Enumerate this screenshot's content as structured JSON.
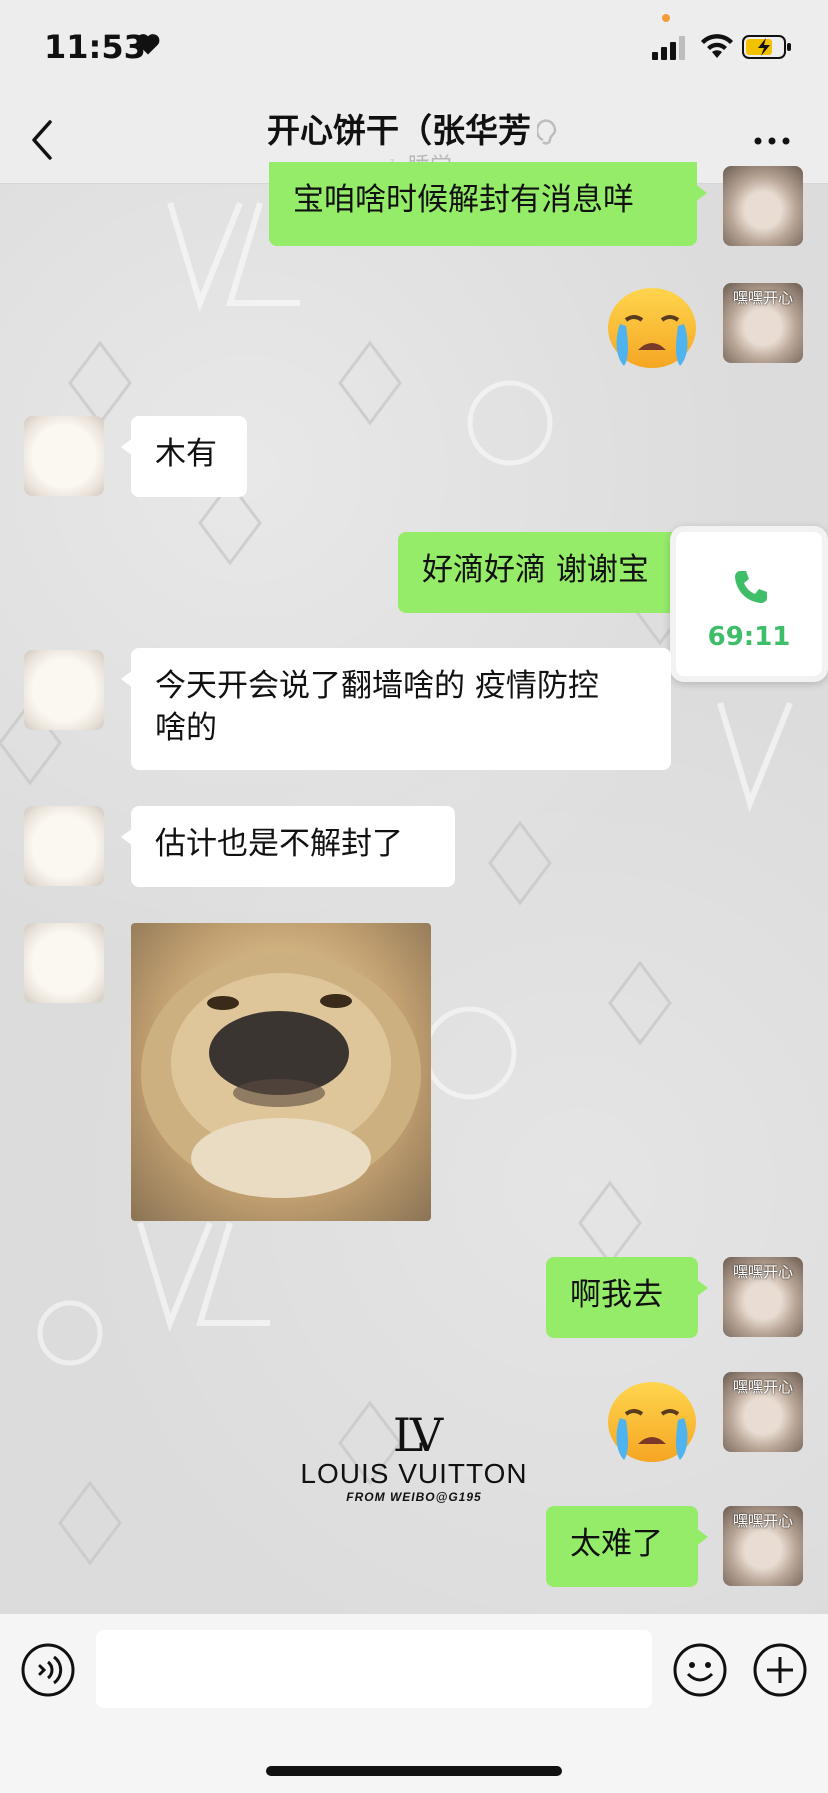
{
  "status_bar": {
    "time": "11:53",
    "icons": [
      "heart-icon",
      "signal-icon",
      "wifi-icon",
      "battery-charging-icon"
    ]
  },
  "header": {
    "title": "开心饼干（张华芳",
    "status": "睡觉",
    "icons": [
      "back-chevron-icon",
      "ear-icon",
      "sleep-icon",
      "more-dots-icon"
    ]
  },
  "avatar_labels": {
    "me": "嘿嘿开心"
  },
  "messages": [
    {
      "sender": "me",
      "type": "text",
      "text": "宝咱啥时候解封有消息咩"
    },
    {
      "sender": "me",
      "type": "emoji",
      "emoji": "loudly-crying-face"
    },
    {
      "sender": "them",
      "type": "text",
      "text": "木有"
    },
    {
      "sender": "me",
      "type": "text",
      "text": "好滴好滴 谢谢宝"
    },
    {
      "sender": "them",
      "type": "text",
      "text_line1": "今天开会说了翻墙啥的 疫情防控",
      "text_line2": "啥的"
    },
    {
      "sender": "them",
      "type": "text",
      "text": "估计也是不解封了"
    },
    {
      "sender": "them",
      "type": "sticker",
      "sticker": "squished-dog-face"
    },
    {
      "sender": "me",
      "type": "text",
      "text": "啊我去"
    },
    {
      "sender": "me",
      "type": "emoji",
      "emoji": "loudly-crying-face"
    },
    {
      "sender": "me",
      "type": "text",
      "text": "太难了"
    }
  ],
  "call_card": {
    "duration": "69:11"
  },
  "watermark": {
    "name": "LOUIS VUITTON",
    "credit": "FROM WEIBO@G195"
  },
  "colors": {
    "my_bubble": "#95ec69",
    "their_bubble": "#ffffff",
    "call_green": "#3fbe69",
    "header_bg": "#ededed"
  }
}
